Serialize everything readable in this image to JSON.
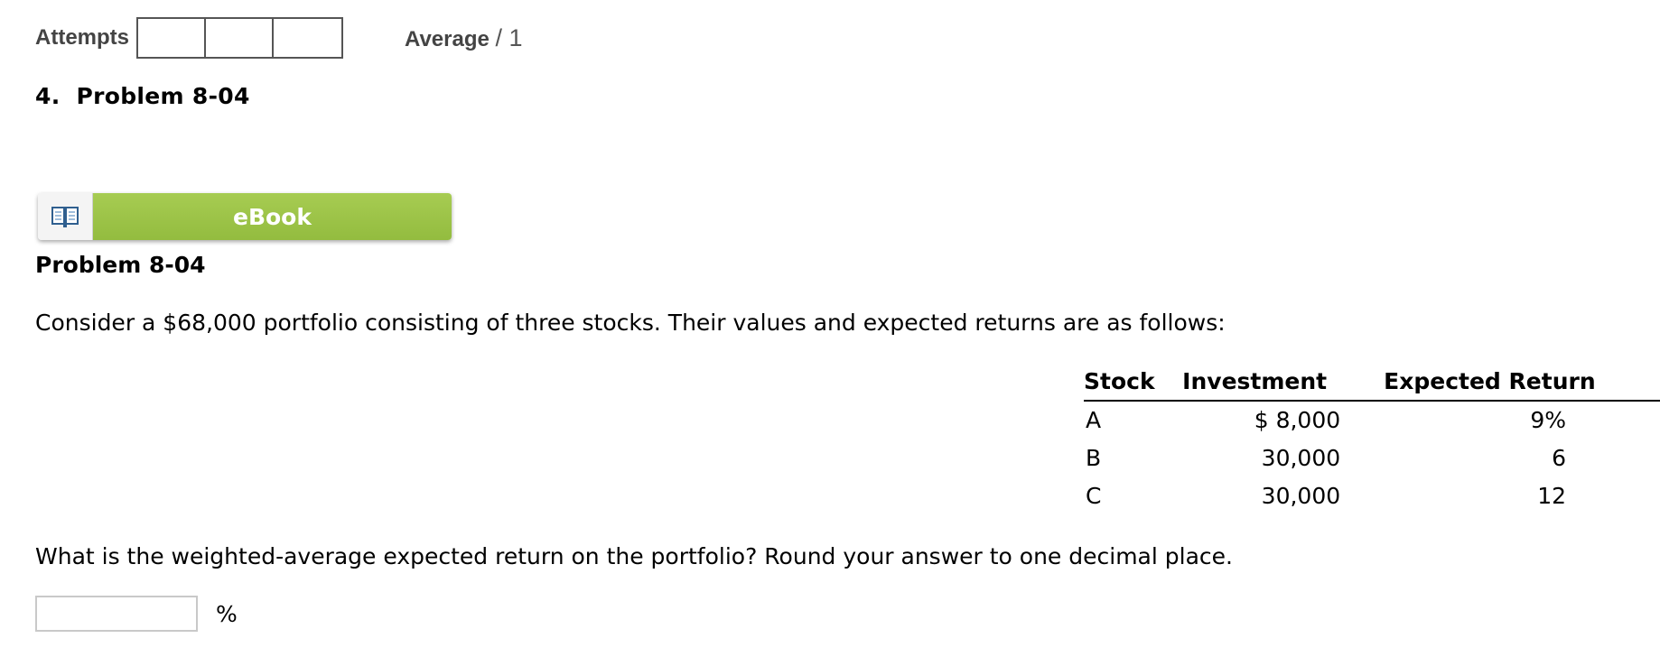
{
  "header": {
    "attempts_label": "Attempts",
    "average_label": "Average",
    "average_total": "/ 1"
  },
  "problem": {
    "number_heading": "4.  Problem 8-04",
    "ebook_label": "eBook",
    "title": "Problem 8-04",
    "description": "Consider a $68,000 portfolio consisting of three stocks. Their values and expected returns are as follows:",
    "question": "What is the weighted-average expected return on the portfolio? Round your answer to one decimal place."
  },
  "table": {
    "headers": {
      "stock": "Stock",
      "investment": "Investment",
      "expected_return": "Expected Return"
    },
    "rows": [
      {
        "stock": "A",
        "investment": "$ 8,000",
        "expected_return": "9%"
      },
      {
        "stock": "B",
        "investment": "30,000",
        "expected_return": "6"
      },
      {
        "stock": "C",
        "investment": "30,000",
        "expected_return": "12"
      }
    ]
  },
  "answer": {
    "value": "",
    "unit": "%"
  },
  "icons": {
    "ebook": "open-book-icon"
  },
  "colors": {
    "ebook_green": "#9dc548",
    "text": "#000000",
    "label_gray": "#444444"
  }
}
